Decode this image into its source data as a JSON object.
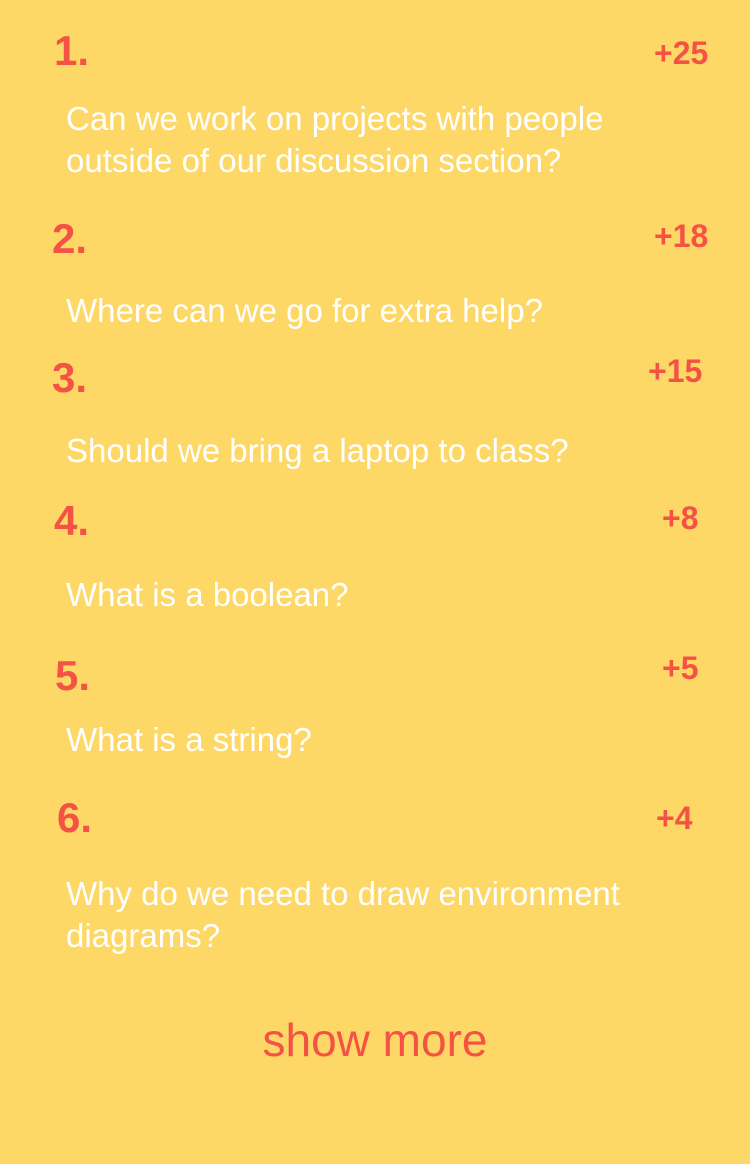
{
  "questions": [
    {
      "rank": "1.",
      "score": "+25",
      "text": "Can we work on projects with people outside of our discussion section?"
    },
    {
      "rank": "2.",
      "score": "+18",
      "text": "Where can we go for extra help?"
    },
    {
      "rank": "3.",
      "score": "+15",
      "text": "Should we bring a laptop to class?"
    },
    {
      "rank": "4.",
      "score": "+8",
      "text": "What is a boolean?"
    },
    {
      "rank": "5.",
      "score": "+5",
      "text": "What is a string?"
    },
    {
      "rank": "6.",
      "score": "+4",
      "text": "Why do we need to draw environment diagrams?"
    }
  ],
  "show_more_label": "show more",
  "colors": {
    "background": "#fdd866",
    "accent": "#f45245",
    "question_text": "#ffffff"
  }
}
